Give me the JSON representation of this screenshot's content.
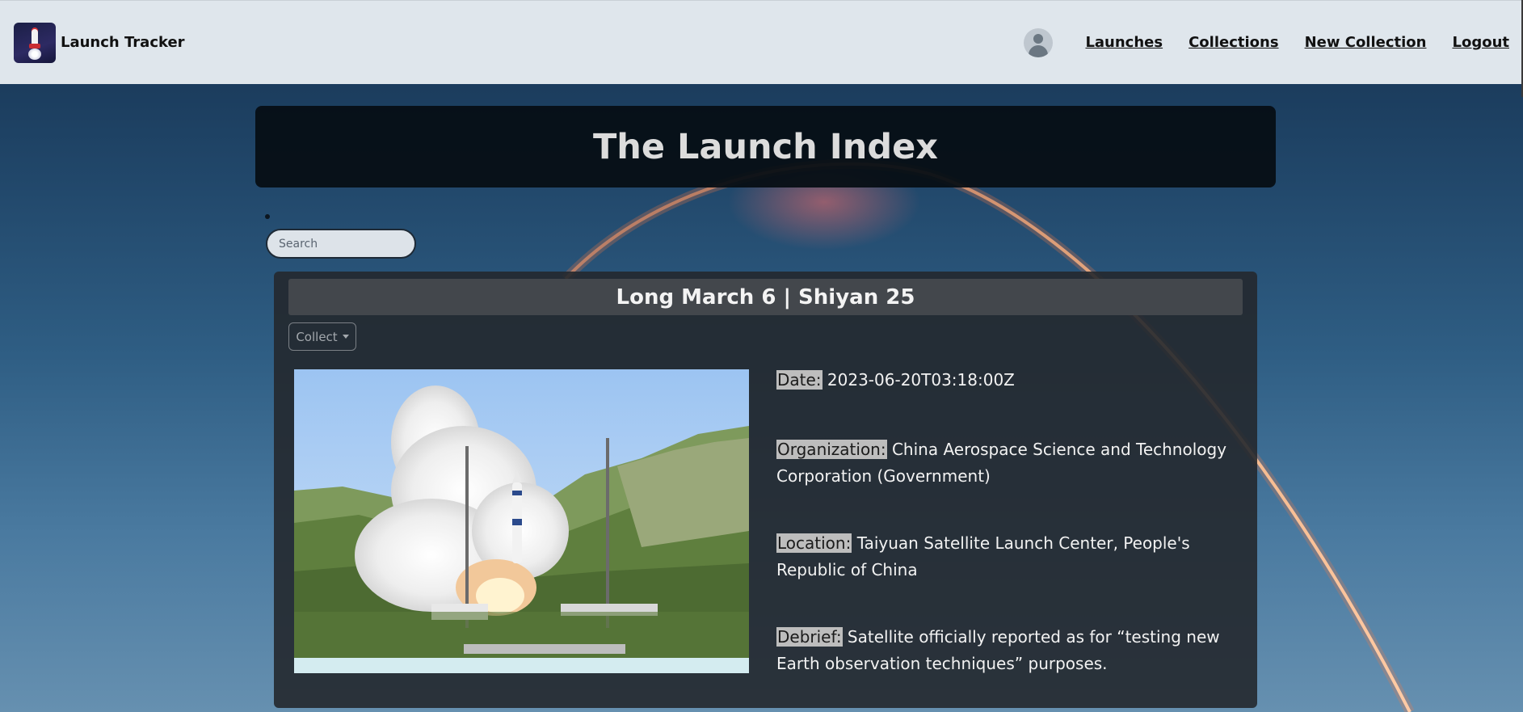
{
  "navbar": {
    "brand_title": "Launch Tracker",
    "brand_icon": "rocket-logo-icon",
    "avatar_icon": "user-avatar-icon",
    "links": [
      "Launches",
      "Collections",
      "New Collection",
      "Logout"
    ]
  },
  "banner": {
    "title": "The Launch Index"
  },
  "search": {
    "placeholder": "Search",
    "value": ""
  },
  "launch_card": {
    "title": "Long March 6 | Shiyan 25",
    "collect_label": "Collect",
    "collect_icon": "caret-down-icon",
    "fields": {
      "date_label": "Date:",
      "date_value": "2023-06-20T03:18:00Z",
      "organization_label": "Organization:",
      "organization_value": "China Aerospace Science and Technology Corporation (Government)",
      "location_label": "Location:",
      "location_value": "Taiyuan Satellite Launch Center, People's Republic of China",
      "debrief_label": "Debrief:",
      "debrief_value": "Satellite officially reported as for “testing new Earth observation techniques” purposes."
    }
  },
  "colors": {
    "navbar_bg": "#dfe6ec",
    "banner_bg": "#060e14",
    "card_bg": "#24282e",
    "label_highlight": "#bdbdbd"
  }
}
